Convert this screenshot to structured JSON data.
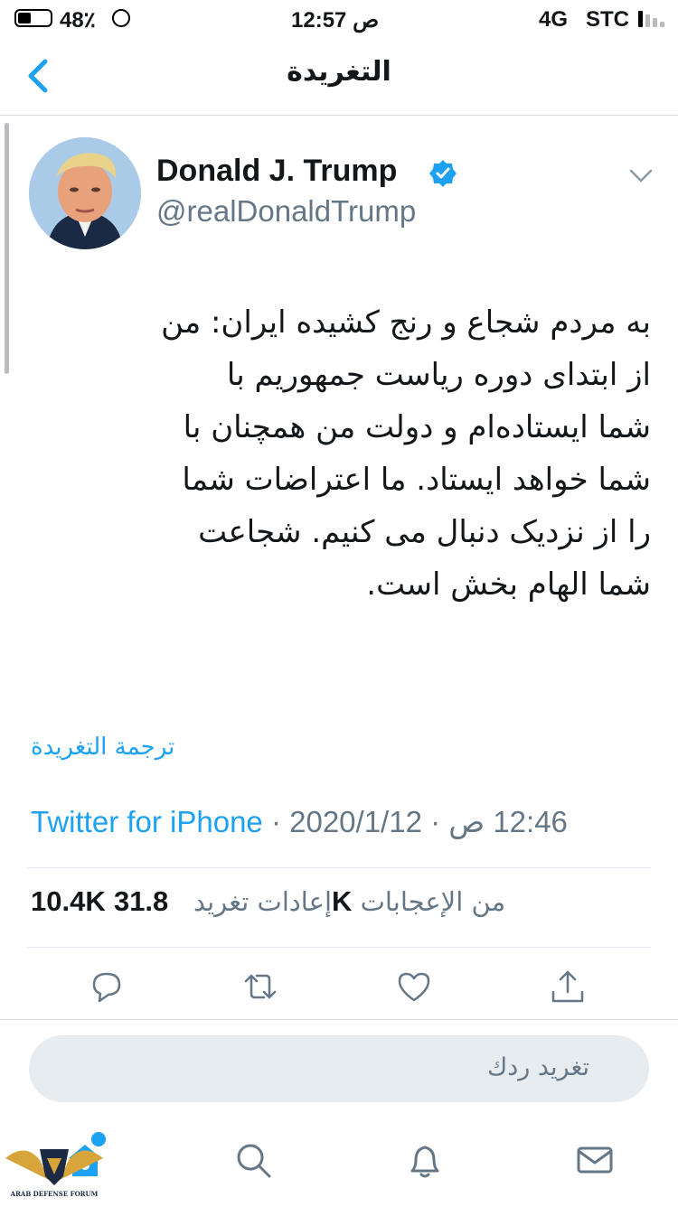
{
  "status_bar": {
    "battery": "48٪",
    "time": "12:57 ص",
    "network": "4G",
    "carrier": "STC"
  },
  "header": {
    "title": "التغريدة",
    "back_icon": "chevron-left-icon"
  },
  "tweet": {
    "author_name": "Donald J. Trump",
    "handle": "@realDonaldTrump",
    "body_lines": [
      "به مردم شجاع و رنج کشیده ایران: من",
      "از ابتدای دوره ریاست جمهوریم با",
      "شما ایستاده‌ام و دولت من همچنان با",
      "شما خواهد ایستاد. ما اعتراضات شما",
      "را از نزدیک دنبال می کنیم. شجاعت",
      "شما الهام بخش است."
    ],
    "translate_label": "ترجمة التغريدة",
    "source": "Twitter for iPhone",
    "date": "2020/1/12",
    "time": "12:46 ص",
    "separator": " · ",
    "retweets_count": "10.4K",
    "retweets_label": "إعادات تغريد",
    "likes_count": "31.8K",
    "likes_label": "من الإعجابات"
  },
  "reply_box": {
    "placeholder": "تغريد ردك"
  },
  "colors": {
    "accent": "#1da1f2",
    "muted": "#657786"
  },
  "watermark": {
    "text": "ARAB DEFENSE FORUM"
  }
}
